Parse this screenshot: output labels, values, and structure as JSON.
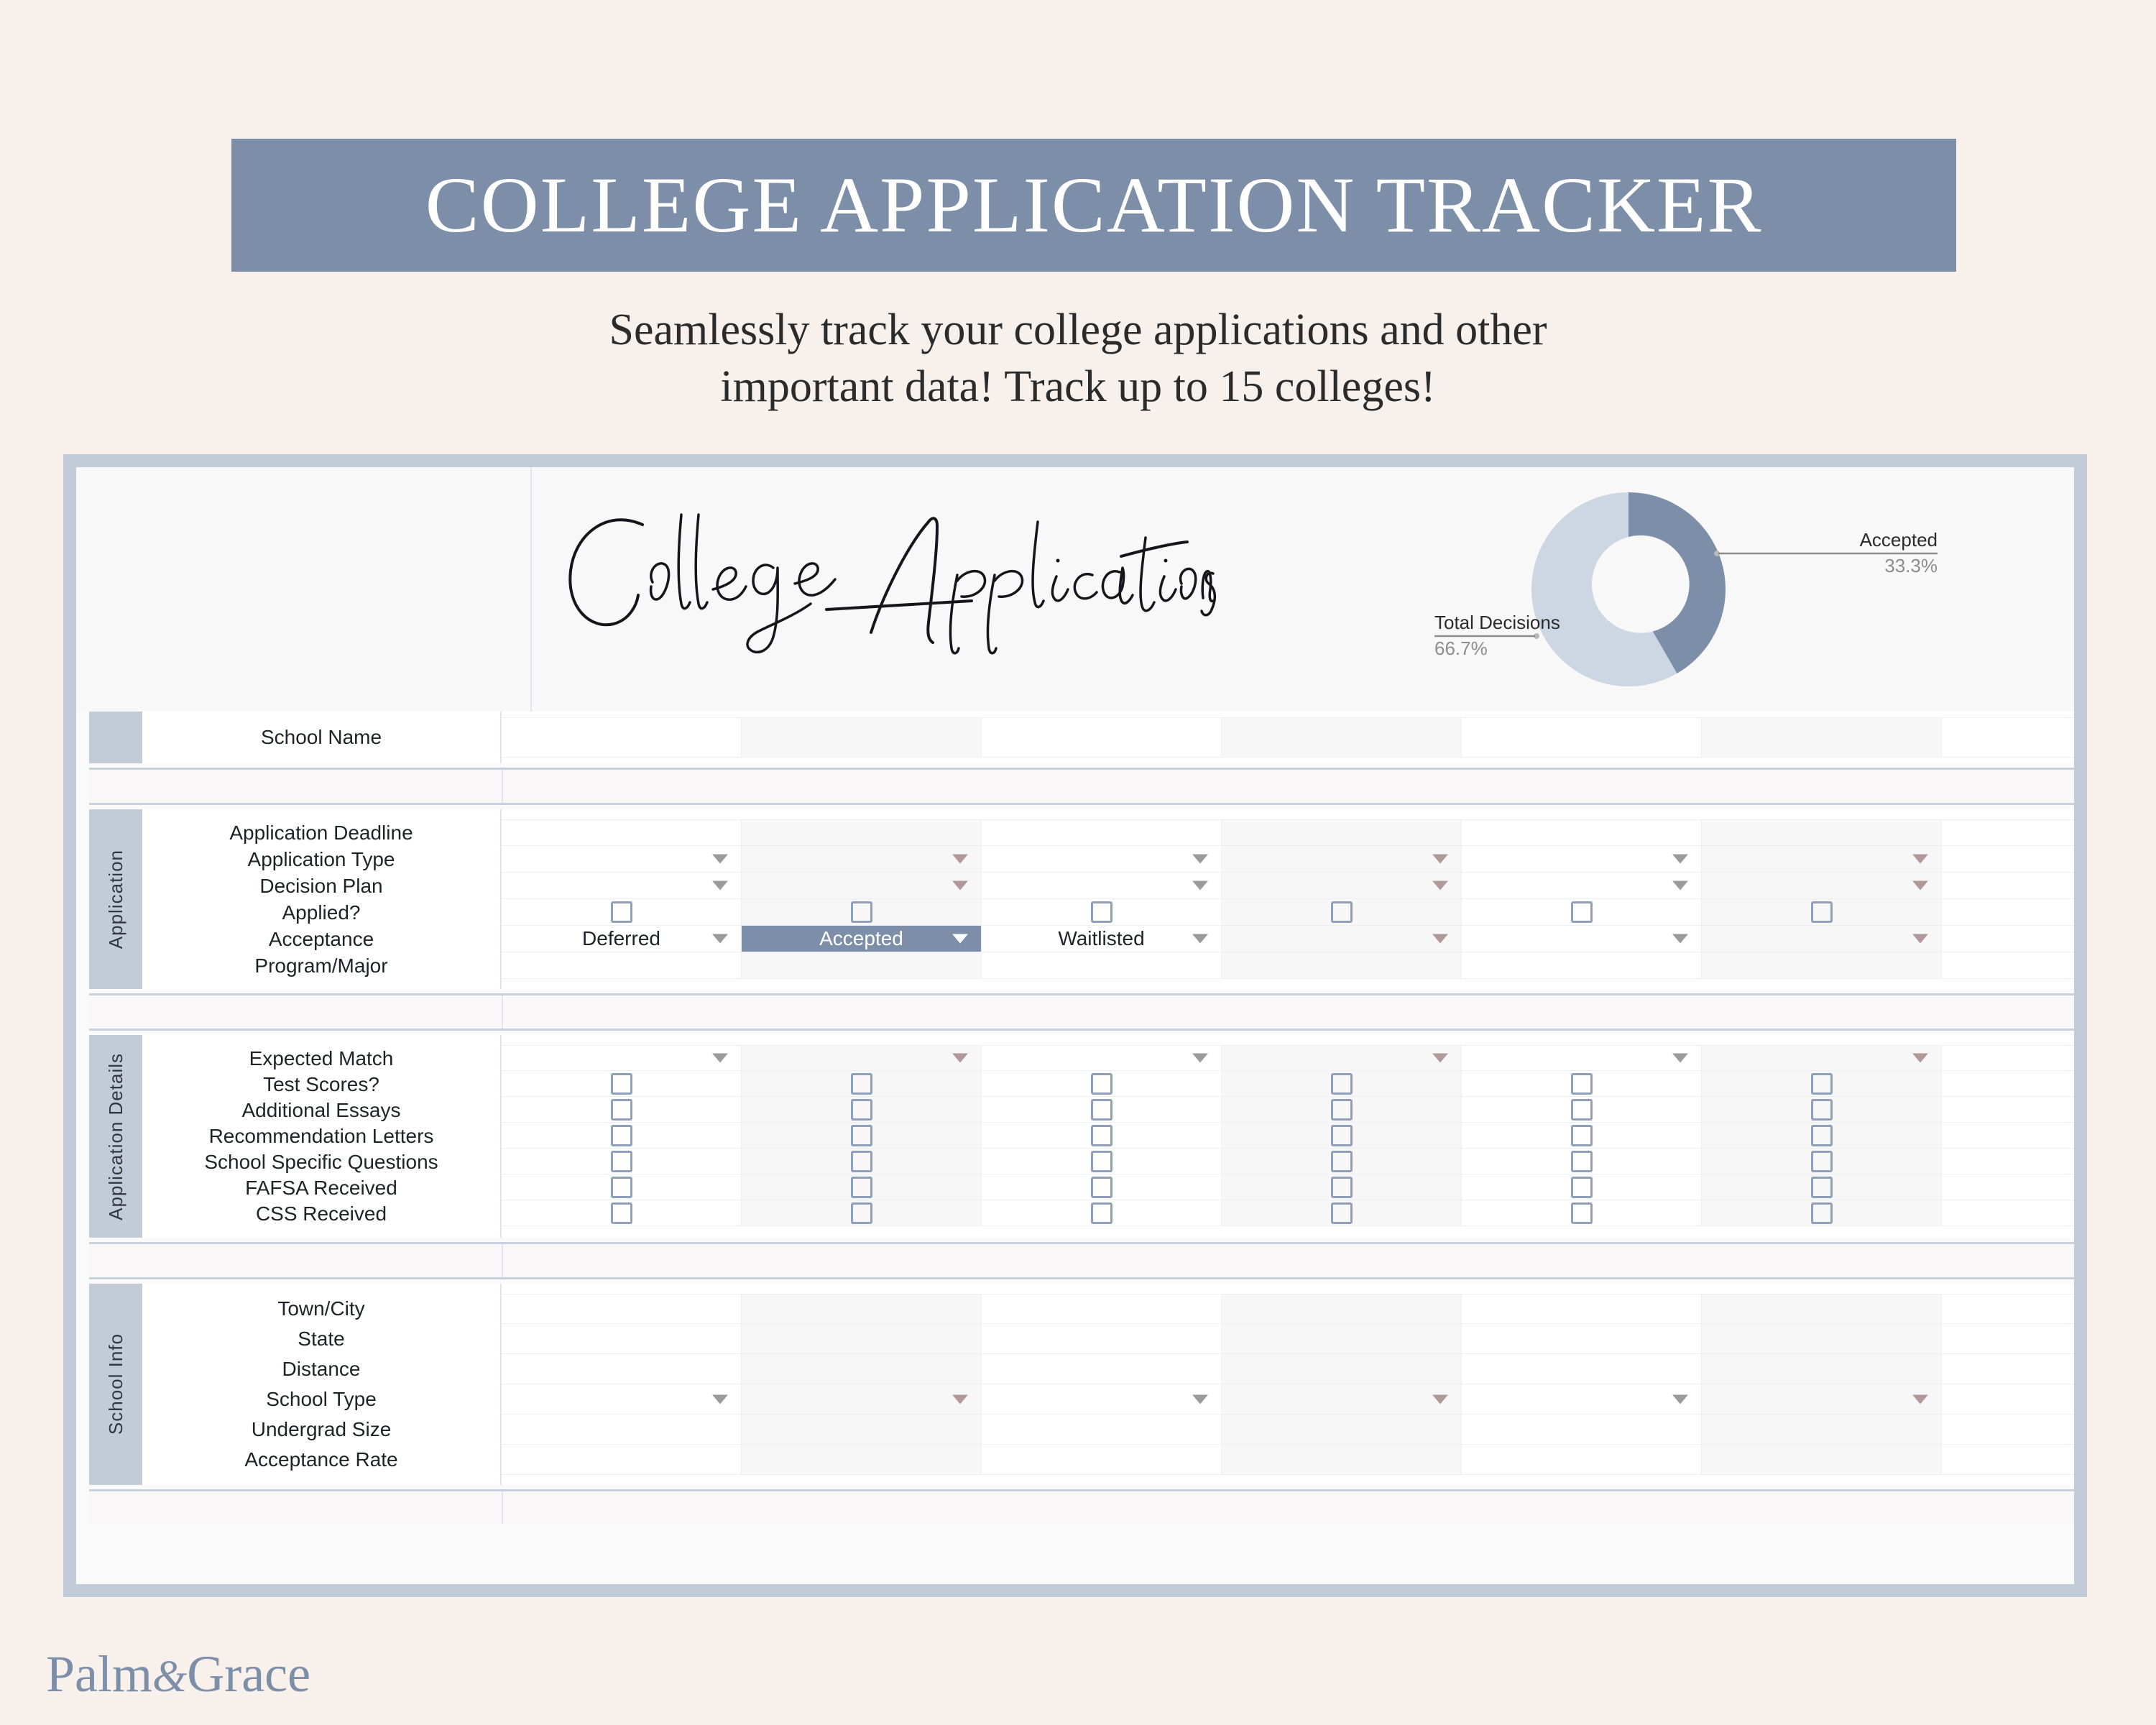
{
  "header": {
    "title": "COLLEGE APPLICATION TRACKER",
    "subtitle_line1": "Seamlessly track your college applications and other",
    "subtitle_line2": "important data! Track up to 15 colleges!",
    "band_color": "#7d8ea8"
  },
  "banner": {
    "script_title": "College Applications"
  },
  "chart_data": {
    "type": "pie",
    "title": "",
    "variant": "donut",
    "categories": [
      "Accepted",
      "Total Decisions"
    ],
    "values": [
      33.3,
      66.7
    ],
    "labels": [
      "Accepted",
      "Total Decisions"
    ],
    "value_labels": [
      "33.3%",
      "66.7%"
    ],
    "colors": [
      "#7d8ea8",
      "#ccd7e3"
    ],
    "legend": "callout-labels",
    "unit": "%"
  },
  "table": {
    "school_name_row": {
      "label": "School Name",
      "cells": [
        "",
        "",
        "",
        "",
        "",
        ""
      ]
    },
    "sections": [
      {
        "tab_label": "Application",
        "rows": [
          {
            "label": "Application Deadline",
            "type": "text",
            "cells": [
              "",
              "",
              "",
              "",
              "",
              ""
            ]
          },
          {
            "label": "Application Type",
            "type": "dropdown",
            "cells": [
              "",
              "",
              "",
              "",
              "",
              ""
            ]
          },
          {
            "label": "Decision Plan",
            "type": "dropdown",
            "cells": [
              "",
              "",
              "",
              "",
              "",
              ""
            ]
          },
          {
            "label": "Applied?",
            "type": "checkbox",
            "cells": [
              "",
              "",
              "",
              "",
              "",
              ""
            ]
          },
          {
            "label": "Acceptance",
            "type": "dropdown",
            "cells": [
              "Deferred",
              "Accepted",
              "Waitlisted",
              "",
              "",
              ""
            ],
            "selected_index": 1
          },
          {
            "label": "Program/Major",
            "type": "text",
            "cells": [
              "",
              "",
              "",
              "",
              "",
              ""
            ]
          }
        ]
      },
      {
        "tab_label": "Application Details",
        "rows": [
          {
            "label": "Expected Match",
            "type": "dropdown",
            "cells": [
              "",
              "",
              "",
              "",
              "",
              ""
            ]
          },
          {
            "label": "Test Scores?",
            "type": "checkbox",
            "cells": [
              "",
              "",
              "",
              "",
              "",
              ""
            ]
          },
          {
            "label": "Additional Essays",
            "type": "checkbox",
            "cells": [
              "",
              "",
              "",
              "",
              "",
              ""
            ]
          },
          {
            "label": "Recommendation Letters",
            "type": "checkbox",
            "cells": [
              "",
              "",
              "",
              "",
              "",
              ""
            ]
          },
          {
            "label": "School Specific Questions",
            "type": "checkbox",
            "cells": [
              "",
              "",
              "",
              "",
              "",
              ""
            ]
          },
          {
            "label": "FAFSA Received",
            "type": "checkbox",
            "cells": [
              "",
              "",
              "",
              "",
              "",
              ""
            ]
          },
          {
            "label": "CSS Received",
            "type": "checkbox",
            "cells": [
              "",
              "",
              "",
              "",
              "",
              ""
            ]
          }
        ]
      },
      {
        "tab_label": "School Info",
        "rows": [
          {
            "label": "Town/City",
            "type": "text",
            "cells": [
              "",
              "",
              "",
              "",
              "",
              ""
            ]
          },
          {
            "label": "State",
            "type": "text",
            "cells": [
              "",
              "",
              "",
              "",
              "",
              ""
            ]
          },
          {
            "label": "Distance",
            "type": "text",
            "cells": [
              "",
              "",
              "",
              "",
              "",
              ""
            ]
          },
          {
            "label": "School Type",
            "type": "dropdown",
            "cells": [
              "",
              "",
              "",
              "",
              "",
              ""
            ]
          },
          {
            "label": "Undergrad Size",
            "type": "text",
            "cells": [
              "",
              "",
              "",
              "",
              "",
              ""
            ]
          },
          {
            "label": "Acceptance Rate",
            "type": "text",
            "cells": [
              "",
              "",
              "",
              "",
              "",
              ""
            ]
          }
        ]
      }
    ]
  },
  "footer": {
    "brand_first": "Palm",
    "brand_amp": "&",
    "brand_last": "Grace",
    "brand_color": "#7d8ea8"
  }
}
